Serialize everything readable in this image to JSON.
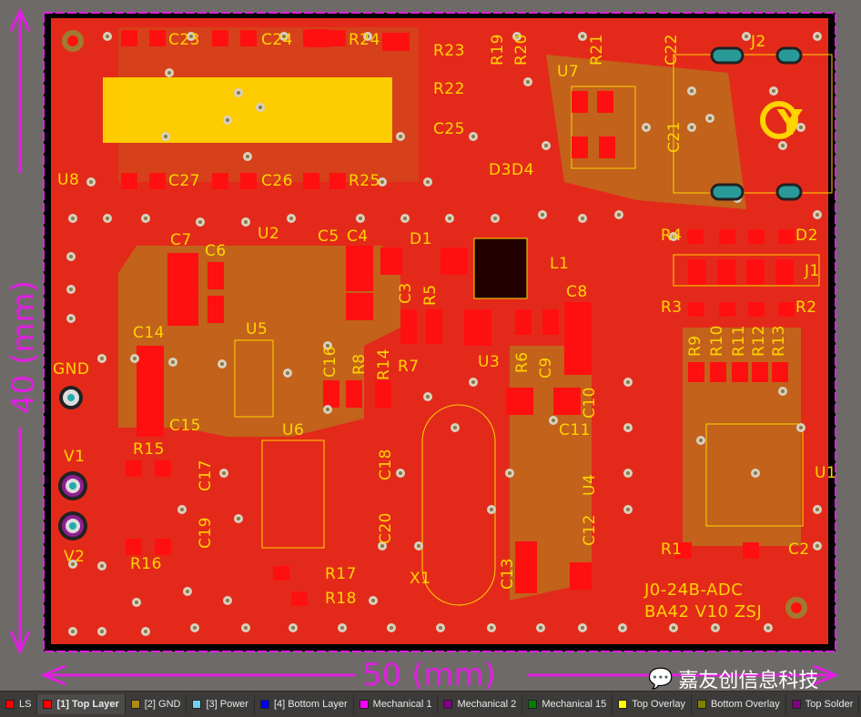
{
  "board": {
    "dimension_vertical": "40 (mm)",
    "dimension_horizontal": "50 (mm)",
    "silk_text_line1": "J0-24B-ADC",
    "silk_text_line2": "BA42 V10 ZSJ",
    "logo": "JY",
    "colors": {
      "top_layer": "#ff1a1a",
      "copper_pour": "#e32a1a",
      "overlay": "#ffd400",
      "outline": "#e020e0",
      "background": "#6e6a68"
    }
  },
  "components": [
    "C23",
    "C24",
    "R24",
    "R23",
    "R19",
    "R20",
    "U7",
    "R21",
    "C22",
    "J2",
    "R22",
    "C25",
    "D3",
    "D4",
    "C21",
    "U8",
    "C27",
    "C26",
    "R25",
    "U2",
    "C7",
    "C6",
    "C5",
    "C4",
    "D1",
    "L1",
    "R4",
    "D2",
    "J1",
    "C3",
    "R5",
    "C8",
    "R3",
    "R2",
    "R9",
    "R10",
    "R11",
    "R12",
    "R13",
    "C14",
    "U5",
    "C16",
    "R8",
    "R14",
    "R7",
    "U3",
    "R6",
    "C9",
    "C10",
    "C15",
    "U6",
    "C11",
    "GND",
    "V1",
    "R15",
    "V2",
    "R16",
    "C19",
    "C17",
    "C18",
    "C20",
    "U4",
    "C12",
    "R1",
    "C2",
    "U1",
    "R17",
    "R18",
    "X1",
    "C13"
  ],
  "layer_tabs": [
    {
      "label": "LS",
      "color": "#ff0000"
    },
    {
      "label": "[1] Top Layer",
      "color": "#ff0000",
      "active": true
    },
    {
      "label": "[2] GND",
      "color": "#b08a18"
    },
    {
      "label": "[3] Power",
      "color": "#70d0f0"
    },
    {
      "label": "[4] Bottom Layer",
      "color": "#0000ff"
    },
    {
      "label": "Mechanical 1",
      "color": "#ff00ff"
    },
    {
      "label": "Mechanical 2",
      "color": "#800080"
    },
    {
      "label": "Mechanical 15",
      "color": "#008000"
    },
    {
      "label": "Top Overlay",
      "color": "#ffff00"
    },
    {
      "label": "Bottom Overlay",
      "color": "#808000"
    },
    {
      "label": "Top Solder",
      "color": "#800080"
    }
  ],
  "watermark": "嘉友创信息科技"
}
